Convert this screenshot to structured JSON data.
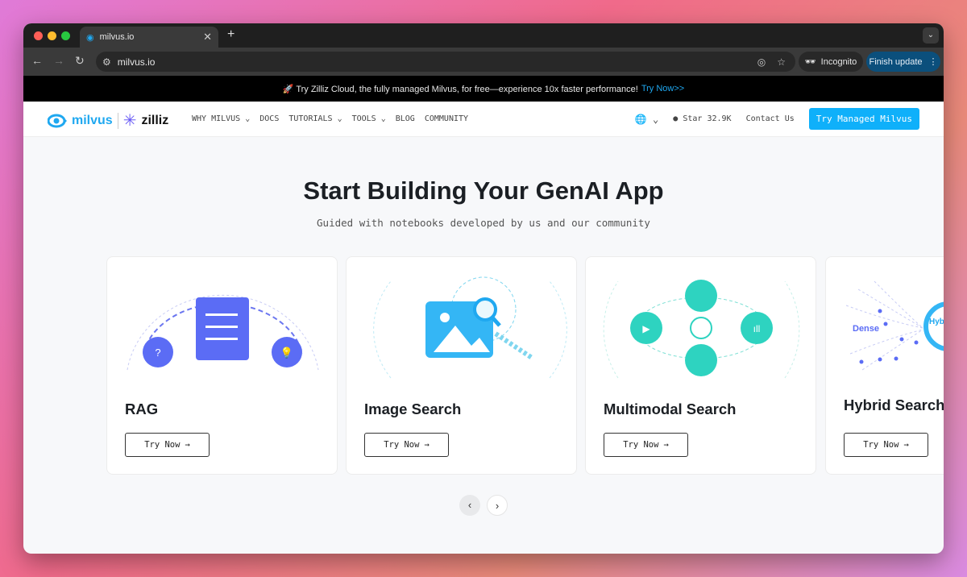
{
  "browser": {
    "tab_title": "milvus.io",
    "url": "milvus.io",
    "incognito_label": "Incognito",
    "update_label": "Finish update"
  },
  "banner": {
    "text": "🚀 Try Zilliz Cloud, the fully managed Milvus, for free—experience 10x faster performance!",
    "link": "Try Now>>"
  },
  "nav": {
    "logo_milvus": "milvus",
    "logo_zilliz": "zilliz",
    "items": [
      {
        "label": "WHY MILVUS",
        "dropdown": true
      },
      {
        "label": "DOCS",
        "dropdown": false
      },
      {
        "label": "TUTORIALS",
        "dropdown": true
      },
      {
        "label": "TOOLS",
        "dropdown": true
      },
      {
        "label": "BLOG",
        "dropdown": false
      },
      {
        "label": "COMMUNITY",
        "dropdown": false
      }
    ],
    "star_label": "Star",
    "star_count": "32.9K",
    "contact": "Contact Us",
    "cta": "Try Managed Milvus"
  },
  "hero": {
    "title": "Start Building Your GenAI App",
    "subtitle": "Guided with notebooks developed by us and our community"
  },
  "cards": [
    {
      "title": "RAG",
      "button": "Try Now"
    },
    {
      "title": "Image Search",
      "button": "Try Now"
    },
    {
      "title": "Multimodal Search",
      "button": "Try Now"
    },
    {
      "title": "Hybrid Search",
      "button": "Try Now",
      "illustration_labels": [
        "Dense",
        "Hybrid Search"
      ]
    }
  ],
  "colors": {
    "accent": "#0fb0fa",
    "rag": "#5b6cf5",
    "teal": "#2ed3c0"
  }
}
